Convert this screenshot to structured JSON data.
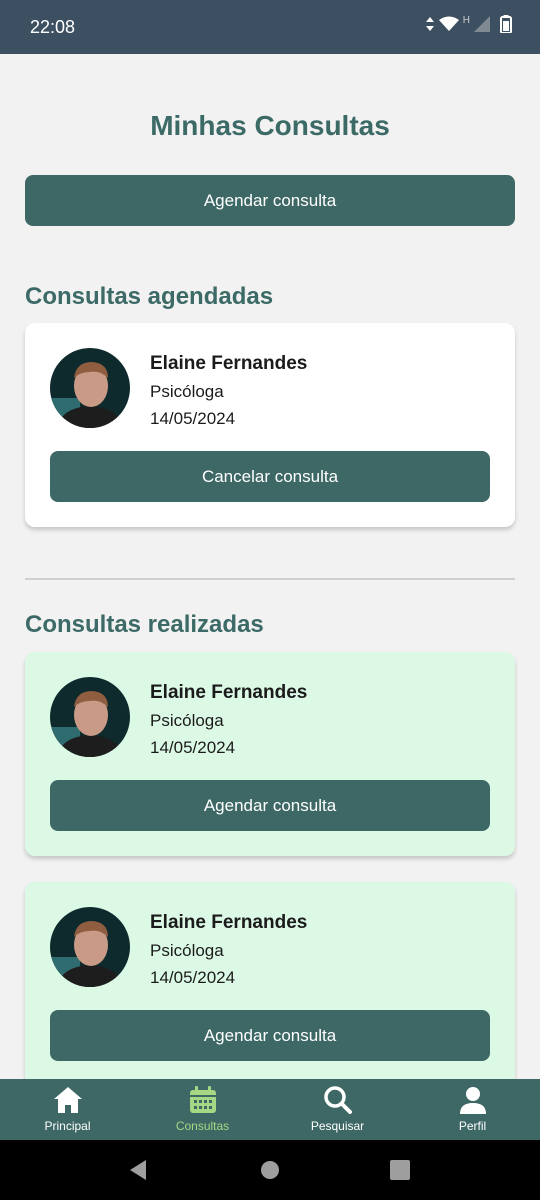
{
  "status_bar": {
    "time": "22:08",
    "network_label": "H"
  },
  "page": {
    "title": "Minhas Consultas",
    "top_button_label": "Agendar consulta"
  },
  "scheduled": {
    "title": "Consultas agendadas",
    "items": [
      {
        "name": "Elaine Fernandes",
        "role": "Psicóloga",
        "date": "14/05/2024",
        "button_label": "Cancelar consulta"
      }
    ]
  },
  "completed": {
    "title": "Consultas realizadas",
    "items": [
      {
        "name": "Elaine Fernandes",
        "role": "Psicóloga",
        "date": "14/05/2024",
        "button_label": "Agendar consulta"
      },
      {
        "name": "Elaine Fernandes",
        "role": "Psicóloga",
        "date": "14/05/2024",
        "button_label": "Agendar consulta"
      }
    ]
  },
  "bottom_nav": {
    "items": [
      {
        "label": "Principal",
        "icon": "home-icon"
      },
      {
        "label": "Consultas",
        "icon": "calendar-icon"
      },
      {
        "label": "Pesquisar",
        "icon": "search-icon"
      },
      {
        "label": "Perfil",
        "icon": "person-icon"
      }
    ],
    "active_index": 1
  },
  "colors": {
    "primary": "#3d6865",
    "title": "#3c6a66",
    "status_bar": "#3d5061",
    "completed_card": "#dcf9e6",
    "active_nav": "#a6d784"
  }
}
